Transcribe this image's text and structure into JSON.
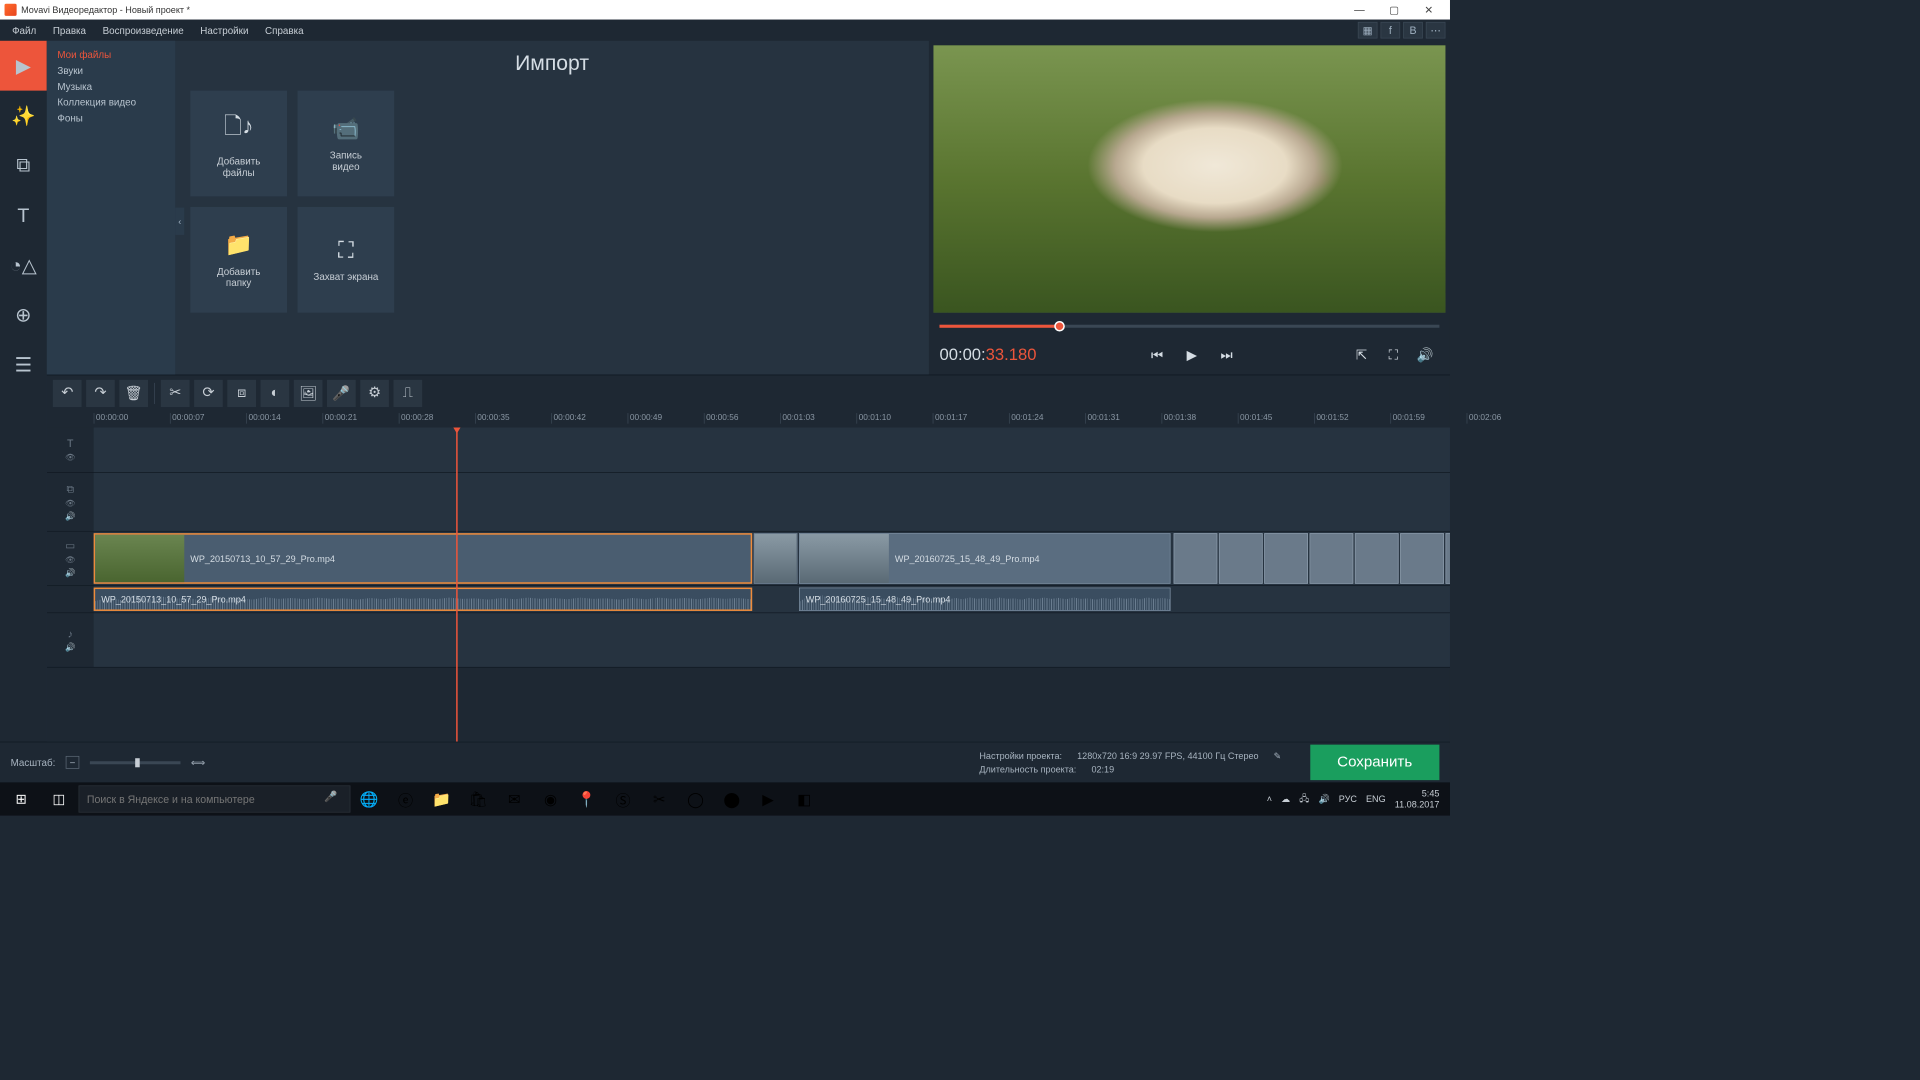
{
  "title": "Movavi Видеоредактор - Новый проект *",
  "menubar": [
    "Файл",
    "Правка",
    "Воспроизведение",
    "Настройки",
    "Справка"
  ],
  "import_title": "Импорт",
  "sidebar": {
    "items": [
      "Мои файлы",
      "Звуки",
      "Музыка",
      "Коллекция видео",
      "Фоны"
    ]
  },
  "tiles": {
    "add_files": "Добавить\nфайлы",
    "record_video": "Запись\nвидео",
    "add_folder": "Добавить\nпапку",
    "screen_capture": "Захват экрана"
  },
  "timecode": {
    "main": "00:00:",
    "frac": "33.180"
  },
  "ruler_ticks": [
    "00:00:00",
    "00:00:07",
    "00:00:14",
    "00:00:21",
    "00:00:28",
    "00:00:35",
    "00:00:42",
    "00:00:49",
    "00:00:56",
    "00:01:03",
    "00:01:10",
    "00:01:17",
    "00:01:24",
    "00:01:31",
    "00:01:38",
    "00:01:45",
    "00:01:52",
    "00:01:59",
    "00:02:06"
  ],
  "clips": {
    "video1": "WP_20150713_10_57_29_Pro.mp4",
    "audio1": "WP_20150713_10_57_29_Pro.mp4",
    "video2": "WP_20160725_15_48_49_Pro.mp4",
    "audio2": "WP_20160725_15_48_49_Pro.mp4"
  },
  "status": {
    "zoom_label": "Масштаб:",
    "settings_label": "Настройки проекта:",
    "settings_value": "1280x720 16:9 29.97 FPS, 44100 Гц Стерео",
    "duration_label": "Длительность проекта:",
    "duration_value": "02:19",
    "save": "Сохранить"
  },
  "taskbar": {
    "search_placeholder": "Поиск в Яндексе и на компьютере",
    "lang": "РУС",
    "lang2": "ENG",
    "time": "5:45",
    "date": "11.08.2017"
  }
}
